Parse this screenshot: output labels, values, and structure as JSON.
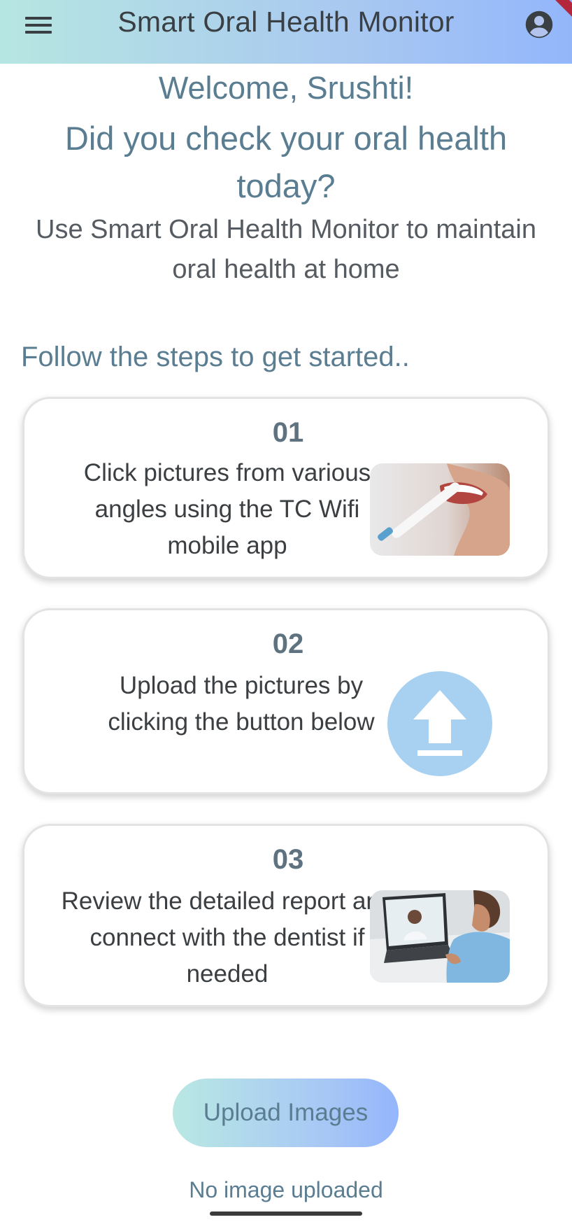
{
  "app_bar": {
    "title": "Smart Oral Health Monitor",
    "menu_icon": "hamburger-menu-icon",
    "profile_icon": "account-circle-icon",
    "gradient_colors": [
      "#b6e6e1",
      "#93b6fb"
    ]
  },
  "welcome": {
    "greeting": "Welcome, Srushti!",
    "question": "Did you check your oral health today?",
    "subtitle": "Use Smart Oral Health Monitor to maintain oral health at home"
  },
  "steps_heading": "Follow the steps to get started..",
  "steps": [
    {
      "number": "01",
      "text": "Click pictures from various angles using the TC Wifi mobile app",
      "image": "toothbrush-mouth-photo"
    },
    {
      "number": "02",
      "text": "Upload the pictures by clicking the button below",
      "image": "upload-icon"
    },
    {
      "number": "03",
      "text": "Review the detailed report and connect with the dentist if needed",
      "image": "video-call-dentist-photo"
    }
  ],
  "upload_button_label": "Upload Images",
  "upload_status": "No image uploaded",
  "colors": {
    "accent_text": "#5a7d91",
    "upload_circle": "#a8d1f1"
  }
}
